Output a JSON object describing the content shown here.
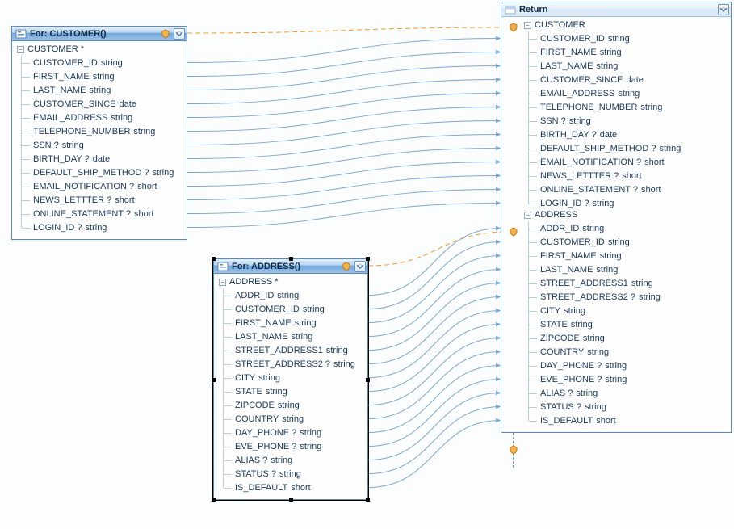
{
  "panels": {
    "customer": {
      "title": "For: CUSTOMER()",
      "root": "CUSTOMER *",
      "fields": [
        {
          "name": "CUSTOMER_ID",
          "type": "string"
        },
        {
          "name": "FIRST_NAME",
          "type": "string"
        },
        {
          "name": "LAST_NAME",
          "type": "string"
        },
        {
          "name": "CUSTOMER_SINCE",
          "type": "date"
        },
        {
          "name": "EMAIL_ADDRESS",
          "type": "string"
        },
        {
          "name": "TELEPHONE_NUMBER",
          "type": "string"
        },
        {
          "name": "SSN ?",
          "type": "string"
        },
        {
          "name": "BIRTH_DAY ?",
          "type": "date"
        },
        {
          "name": "DEFAULT_SHIP_METHOD ?",
          "type": "string"
        },
        {
          "name": "EMAIL_NOTIFICATION ?",
          "type": "short"
        },
        {
          "name": "NEWS_LETTTER ?",
          "type": "short"
        },
        {
          "name": "ONLINE_STATEMENT ?",
          "type": "short"
        },
        {
          "name": "LOGIN_ID ?",
          "type": "string"
        }
      ]
    },
    "address": {
      "title": "For: ADDRESS()",
      "root": "ADDRESS *",
      "fields": [
        {
          "name": "ADDR_ID",
          "type": "string"
        },
        {
          "name": "CUSTOMER_ID",
          "type": "string"
        },
        {
          "name": "FIRST_NAME",
          "type": "string"
        },
        {
          "name": "LAST_NAME",
          "type": "string"
        },
        {
          "name": "STREET_ADDRESS1",
          "type": "string"
        },
        {
          "name": "STREET_ADDRESS2 ?",
          "type": "string"
        },
        {
          "name": "CITY",
          "type": "string"
        },
        {
          "name": "STATE",
          "type": "string"
        },
        {
          "name": "ZIPCODE",
          "type": "string"
        },
        {
          "name": "COUNTRY",
          "type": "string"
        },
        {
          "name": "DAY_PHONE ?",
          "type": "string"
        },
        {
          "name": "EVE_PHONE ?",
          "type": "string"
        },
        {
          "name": "ALIAS ?",
          "type": "string"
        },
        {
          "name": "STATUS ?",
          "type": "string"
        },
        {
          "name": "IS_DEFAULT",
          "type": "short"
        }
      ]
    },
    "return": {
      "title": "Return",
      "groups": [
        {
          "name": "CUSTOMER",
          "fields": [
            {
              "name": "CUSTOMER_ID",
              "type": "string"
            },
            {
              "name": "FIRST_NAME",
              "type": "string"
            },
            {
              "name": "LAST_NAME",
              "type": "string"
            },
            {
              "name": "CUSTOMER_SINCE",
              "type": "date"
            },
            {
              "name": "EMAIL_ADDRESS",
              "type": "string"
            },
            {
              "name": "TELEPHONE_NUMBER",
              "type": "string"
            },
            {
              "name": "SSN ?",
              "type": "string"
            },
            {
              "name": "BIRTH_DAY ?",
              "type": "date"
            },
            {
              "name": "DEFAULT_SHIP_METHOD ?",
              "type": "string"
            },
            {
              "name": "EMAIL_NOTIFICATION ?",
              "type": "short"
            },
            {
              "name": "NEWS_LETTTER ?",
              "type": "short"
            },
            {
              "name": "ONLINE_STATEMENT ?",
              "type": "short"
            },
            {
              "name": "LOGIN_ID ?",
              "type": "string"
            }
          ]
        },
        {
          "name": "ADDRESS",
          "fields": [
            {
              "name": "ADDR_ID",
              "type": "string"
            },
            {
              "name": "CUSTOMER_ID",
              "type": "string"
            },
            {
              "name": "FIRST_NAME",
              "type": "string"
            },
            {
              "name": "LAST_NAME",
              "type": "string"
            },
            {
              "name": "STREET_ADDRESS1",
              "type": "string"
            },
            {
              "name": "STREET_ADDRESS2 ?",
              "type": "string"
            },
            {
              "name": "CITY",
              "type": "string"
            },
            {
              "name": "STATE",
              "type": "string"
            },
            {
              "name": "ZIPCODE",
              "type": "string"
            },
            {
              "name": "COUNTRY",
              "type": "string"
            },
            {
              "name": "DAY_PHONE ?",
              "type": "string"
            },
            {
              "name": "EVE_PHONE ?",
              "type": "string"
            },
            {
              "name": "ALIAS ?",
              "type": "string"
            },
            {
              "name": "STATUS ?",
              "type": "string"
            },
            {
              "name": "IS_DEFAULT",
              "type": "short"
            }
          ]
        }
      ]
    }
  },
  "expander_symbol": "−",
  "colors": {
    "line": "#7da8d0",
    "dash": "#f19a2c"
  }
}
